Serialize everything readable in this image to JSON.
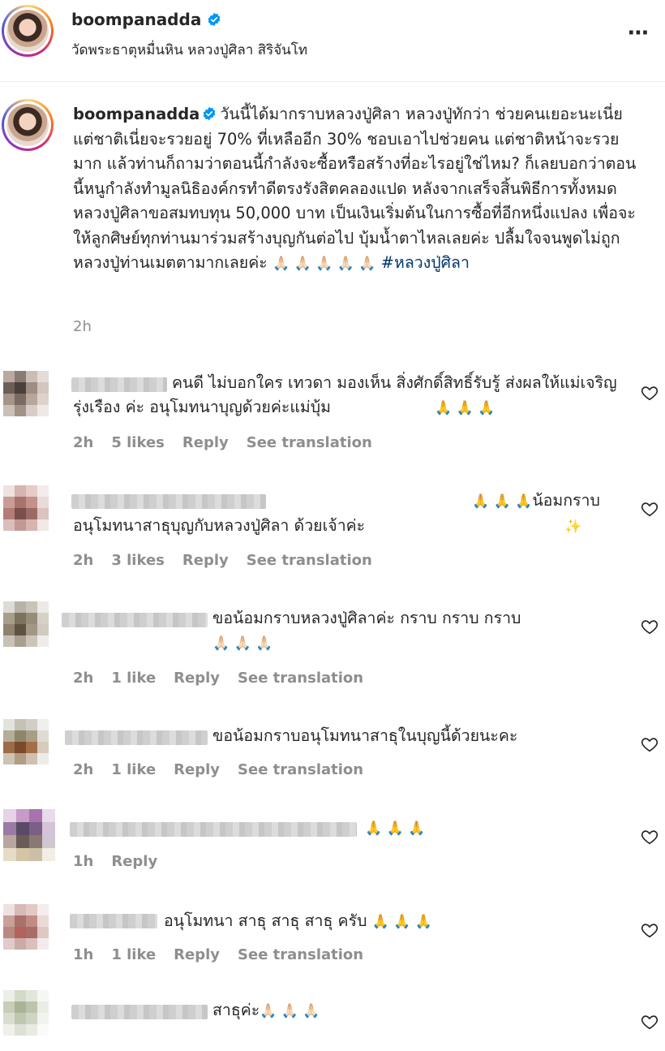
{
  "header": {
    "username": "boompanadda",
    "location": "วัดพระธาตุหมื่นหิน หลวงปู่ศิลา สิริจันโท",
    "more_icon": "⋯"
  },
  "caption": {
    "username": "boompanadda",
    "text": "วันนี้ได้มากราบหลวงปู่ศิลา หลวงปู่ทักว่า ช่วยคนเยอะนะเนี่ย แต่ชาติเนี่ยจะรวยอยู่ 70% ที่เหลืออีก 30% ชอบเอาไปช่วยคน แต่ชาติหน้าจะรวยมาก แล้วท่านก็ถามว่าตอนนี้กำลังจะซื้อหรือสร้างที่อะไรอยู่ใช่ไหม? ก็เลยบอกว่าตอนนี้หนูกำลังทำมูลนิธิองค์กรทำดีตรงรังสิตคลองแปด หลังจากเสร็จสิ้นพิธีการทั้งหมด หลวงปู่ศิลาขอสมทบทุน 50,000 บาท เป็นเงินเริ่มต้นในการซื้อที่อีกหนึ่งแปลง เพื่อจะให้ลูกศิษย์ทุกท่านมาร่วมสร้างบุญกันต่อไป บุ้มน้ำตาไหลเลยค่ะ ปลื้มใจจนพูดไม่ถูก หลวงปู่ท่านเมตตามากเลยค่ะ",
    "emojis": "🙏🏻 🙏🏻 🙏🏻 🙏🏻 🙏🏻",
    "hashtag": "#หลวงปู่ศิลา",
    "time": "2h"
  },
  "comments": [
    {
      "text": "คนดี ไม่บอกใคร เทวดา มองเห็น สิ่งศักดิ์สิทธิ์รับรู้ ส่งผลให้แม่เจริญรุ่งเรือง ค่ะ อนุโมทนาบุญด้วยค่ะแม่บุ้ม",
      "emojis": "🙏 🙏 🙏",
      "time": "2h",
      "likes": "5 likes",
      "reply": "Reply",
      "translate": "See translation"
    },
    {
      "text": "น้อมกราบอนุโมทนาสาธุบุญกับหลวงปู่ศิลา ด้วยเจ้าค่ะ",
      "emojis_before": "🙏 🙏 🙏",
      "emojis": "✨",
      "time": "2h",
      "likes": "3 likes",
      "reply": "Reply",
      "translate": "See translation"
    },
    {
      "text": "ขอน้อมกราบหลวงปู่ศิลาค่ะ กราบ กราบ กราบ",
      "emojis": "🙏🏻 🙏🏻 🙏🏻",
      "time": "2h",
      "likes": "1 like",
      "reply": "Reply",
      "translate": "See translation"
    },
    {
      "text": "ขอน้อมกราบอนุโมทนาสาธุในบุญนี้ด้วยนะคะ",
      "emojis": "",
      "time": "2h",
      "likes": "1 like",
      "reply": "Reply",
      "translate": "See translation"
    },
    {
      "text": "",
      "emojis": "🙏 🙏 🙏",
      "time": "1h",
      "likes": "",
      "reply": "Reply",
      "translate": ""
    },
    {
      "text": "อนุโมทนา สาธุ สาธุ สาธุ ครับ",
      "emojis": "🙏 🙏 🙏",
      "time": "1h",
      "likes": "1 like",
      "reply": "Reply",
      "translate": "See translation"
    },
    {
      "text": "สาธุค่ะ",
      "emojis": "🙏🏻 🙏🏻 🙏🏻",
      "time": "",
      "likes": "",
      "reply": "",
      "translate": ""
    }
  ],
  "icons": {
    "verified": "verified-badge-icon",
    "heart": "heart-outline-icon",
    "more": "more-dots-icon"
  },
  "colors": {
    "verified": "#0095f6",
    "hashtag": "#00376b",
    "meta": "#8e8e8e"
  }
}
